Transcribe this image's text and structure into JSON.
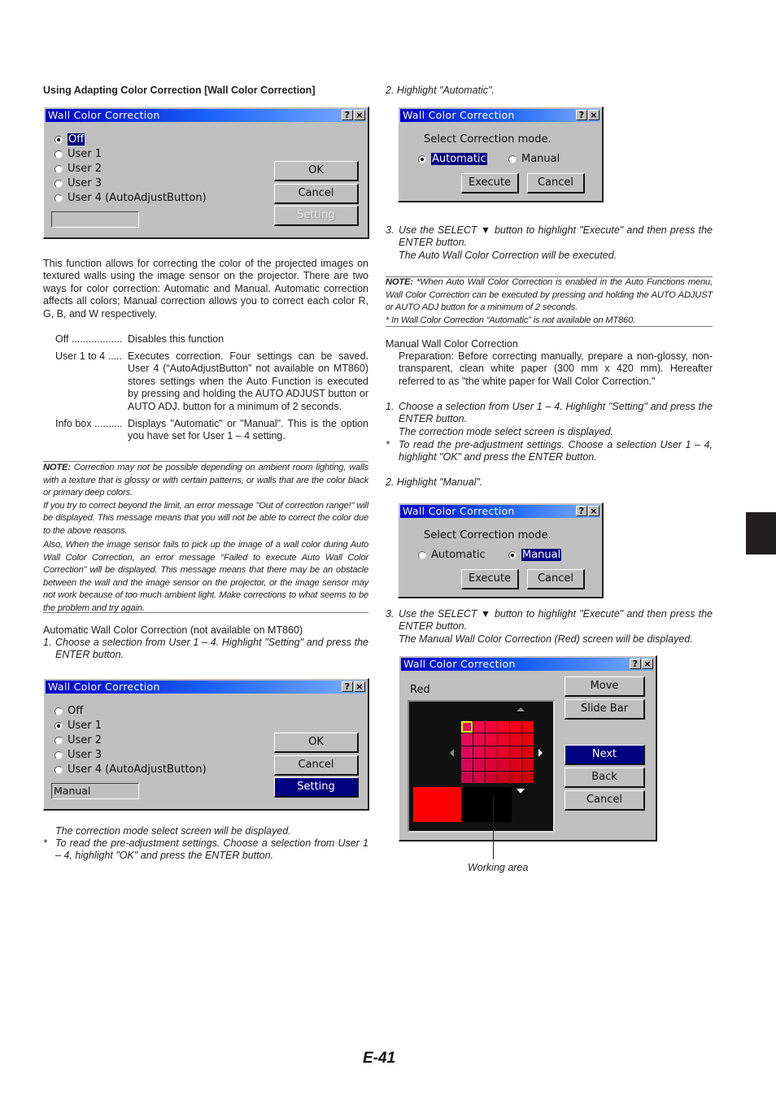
{
  "left": {
    "heading": "Using Adapting Color Correction [Wall Color Correction]",
    "dialog1": {
      "title": "Wall Color Correction",
      "help_btn": "?",
      "close_btn": "×",
      "options": [
        "Off",
        "User 1",
        "User 2",
        "User 3",
        "User 4 (AutoAdjustButton)"
      ],
      "selected": "Off",
      "info_box": "",
      "ok": "OK",
      "cancel": "Cancel",
      "setting": "Setting"
    },
    "intro": "This function allows for correcting the color of the projected images on textured walls using the image sensor on the projector. There are two ways for color correction: Automatic and Manual. Automatic correction affects all colors; Manual correction allows you to correct each color R, G, B, and W respectively.",
    "definitions": [
      {
        "term": "Off ..................",
        "desc": "Disables this function"
      },
      {
        "term": "User 1 to 4 .....",
        "desc": "Executes correction. Four settings can be saved. User 4 (“AutoAdjustButton” not available on MT860) stores settings when the Auto Function is executed by pressing and holding the AUTO ADJUST button or AUTO ADJ. button for a minimum of 2 seconds."
      },
      {
        "term": "Info box ..........",
        "desc": "Displays \"Automatic\" or \"Manual\". This is the option you have set for User 1 – 4 setting."
      }
    ],
    "note": {
      "label": "NOTE:",
      "p1": " Correction may not be possible depending on ambient room lighting, walls with a texture that is glossy or with certain patterns, or walls that are the color black or primary deep colors.",
      "p2": "If you try to correct beyond the limit, an error message \"Out of correction range!\" will be displayed. This message means that you will not be able to correct the color due to the above reasons.",
      "p3": "Also, When the image sensor fails to pick up the image of a wall color during Auto Wall Color Correction, an error message \"Failed to execute Auto Wall Color Correction\" will be displayed. This message means that there may be an obstacle between the wall and the image sensor on the projector, or the image sensor may not work because of too much ambient light. Make corrections to what seems to be the problem and try again."
    },
    "auto_heading": "Automatic Wall Color Correction (not available on MT860)",
    "step1_num": "1.",
    "step1": "Choose a selection from User 1 – 4. Highlight \"Setting\" and press the ENTER button.",
    "dialog2": {
      "title": "Wall Color Correction",
      "help_btn": "?",
      "close_btn": "×",
      "options": [
        "Off",
        "User 1",
        "User 2",
        "User 3",
        "User 4 (AutoAdjustButton)"
      ],
      "selected": "User 1",
      "info_box": "Manual",
      "ok": "OK",
      "cancel": "Cancel",
      "setting": "Setting"
    },
    "after1": "The correction mode select screen will be displayed.",
    "star": "*",
    "after1_note": "To read the pre-adjustment settings. Choose a selection from User 1 – 4, highlight \"OK\" and press the ENTER button."
  },
  "right": {
    "step2_auto": "2. Highlight \"Automatic\".",
    "dialog3": {
      "title": "Wall Color Correction",
      "help_btn": "?",
      "close_btn": "×",
      "prompt": "Select Correction mode.",
      "opt_auto": "Automatic",
      "opt_manual": "Manual",
      "selected": "Automatic",
      "execute": "Execute",
      "cancel": "Cancel"
    },
    "step3_auto_num": "3.",
    "step3_auto": "Use the SELECT ▼ button to highlight \"Execute\" and then press the ENTER button.",
    "step3_auto_result": "The Auto Wall Color Correction will be executed.",
    "note": {
      "label": "NOTE:",
      "p1": " *When Auto Wall Color Correction is enabled in the Auto Functions menu, Wall Color Correction can be executed by pressing and holding the AUTO ADJUST or AUTO ADJ button for a minimum of 2 seconds.",
      "p2": "* In Wall Color Correction “Automatic” is not available on MT860."
    },
    "manual_heading": "Manual Wall Color Correction",
    "preparation": "Preparation: Before correcting manually, prepare a non-glossy, non-transparent, clean white paper (300 mm x 420 mm). Hereafter referred to as \"the white paper for Wall Color Correction.\"",
    "m_step1_num": "1.",
    "m_step1": "Choose a selection from User 1 – 4. Highlight \"Setting\" and press the ENTER button.",
    "m_step1_result": "The correction mode select screen is displayed.",
    "m_star": "*",
    "m_step1_note": "To read the pre-adjustment settings. Choose a selection User 1 – 4, highlight \"OK\" and press the ENTER button.",
    "step2_manual": "2. Highlight \"Manual\".",
    "dialog4": {
      "title": "Wall Color Correction",
      "help_btn": "?",
      "close_btn": "×",
      "prompt": "Select Correction mode.",
      "opt_auto": "Automatic",
      "opt_manual": "Manual",
      "selected": "Manual",
      "execute": "Execute",
      "cancel": "Cancel"
    },
    "step3_manual_num": "3.",
    "step3_manual": "Use the SELECT ▼ button to highlight \"Execute\" and then press the ENTER button.",
    "step3_manual_result": "The Manual Wall Color Correction (Red) screen will be displayed.",
    "dialog5": {
      "title": "Wall Color Correction",
      "help_btn": "?",
      "close_btn": "×",
      "color_label": "Red",
      "buttons": [
        "Move",
        "Slide Bar",
        "Next",
        "Back",
        "Cancel"
      ],
      "selected_button": "Next",
      "reference_color": "#ff0000",
      "grid_colors": [
        [
          "#f0125a",
          "#f8064a",
          "#f8023a",
          "#f8022a",
          "#f8001a",
          "#f8000a"
        ],
        [
          "#e80a5a",
          "#e8084a",
          "#e8063a",
          "#e8042a",
          "#e8021a",
          "#e8000a"
        ],
        [
          "#e0085a",
          "#e0064a",
          "#e0043a",
          "#e0022a",
          "#e0001a",
          "#e0000a"
        ],
        [
          "#d80658",
          "#d80448",
          "#d80238",
          "#d80028",
          "#d80018",
          "#d80008"
        ],
        [
          "#cc0450",
          "#cc0440",
          "#cc0230",
          "#cc0020",
          "#cc0010",
          "#cc0004"
        ]
      ],
      "selected_cell": [
        0,
        0
      ]
    },
    "callout": "Working area"
  },
  "page_number": "E-41",
  "accent_color": "#000080"
}
